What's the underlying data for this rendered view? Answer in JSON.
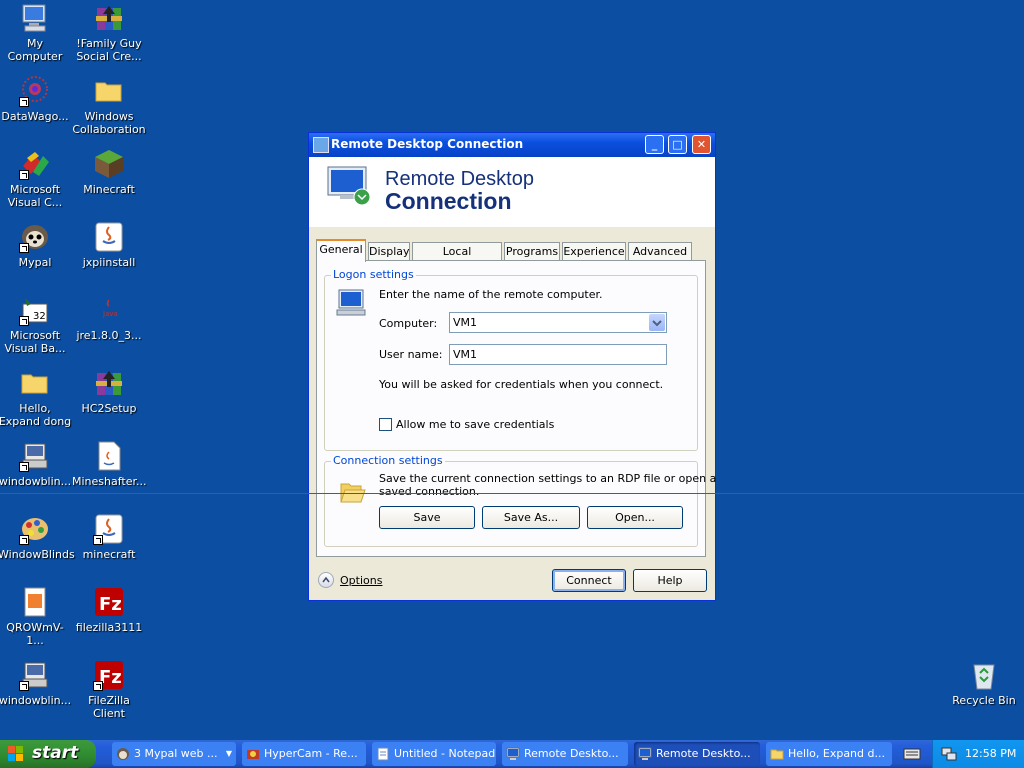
{
  "desktop": {
    "icons": [
      {
        "label": "My Computer",
        "icon": "my-computer-icon"
      },
      {
        "label": "!Family Guy Social Cre...",
        "icon": "winrar-archive-icon"
      },
      {
        "label": "DataWago...",
        "icon": "datawagon-icon"
      },
      {
        "label": "Windows Collaboration",
        "icon": "folder-icon"
      },
      {
        "label": "Microsoft Visual C...",
        "icon": "visual-cpp-icon"
      },
      {
        "label": "Minecraft",
        "icon": "minecraft-icon"
      },
      {
        "label": "Mypal",
        "icon": "mypal-icon"
      },
      {
        "label": "jxpiinstall",
        "icon": "java-icon"
      },
      {
        "label": "Microsoft Visual Ba...",
        "icon": "visual-basic-icon"
      },
      {
        "label": "jre1.8.0_3...",
        "icon": "java-installer-icon"
      },
      {
        "label": "Hello, Expand dong",
        "icon": "folder-icon"
      },
      {
        "label": "HC2Setup",
        "icon": "winrar-archive-icon"
      },
      {
        "label": "windowblin...",
        "icon": "installer-icon"
      },
      {
        "label": "Mineshafter...",
        "icon": "document-icon"
      },
      {
        "label": "WindowBlinds",
        "icon": "windowblinds-icon"
      },
      {
        "label": "minecraft",
        "icon": "java-icon"
      },
      {
        "label": "QROWmV-1...",
        "icon": "image-file-icon"
      },
      {
        "label": "filezilla3111",
        "icon": "filezilla-icon"
      },
      {
        "label": "windowblin...",
        "icon": "installer-icon"
      },
      {
        "label": "FileZilla Client",
        "icon": "filezilla-icon"
      },
      {
        "label": "Recycle Bin",
        "icon": "recycle-bin-icon"
      }
    ]
  },
  "window": {
    "title": "Remote Desktop Connection",
    "banner_line1": "Remote Desktop",
    "banner_line2": "Connection",
    "tabs": [
      "General",
      "Display",
      "Local Resources",
      "Programs",
      "Experience",
      "Advanced"
    ],
    "active_tab": "General",
    "logon": {
      "group_title": "Logon settings",
      "intro": "Enter the name of the remote computer.",
      "computer_label": "Computer:",
      "computer_value": "VM1",
      "username_label": "User name:",
      "username_value": "VM1",
      "credentials_note": "You will be asked for credentials when you connect.",
      "save_credentials_label": "Allow me to save credentials",
      "save_credentials_checked": false
    },
    "connection": {
      "group_title": "Connection settings",
      "desc_line1": "Save the current connection settings to an RDP file or open a",
      "desc_line2": "saved connection.",
      "save_label": "Save",
      "save_as_label": "Save As...",
      "open_label": "Open..."
    },
    "options_label": "Options",
    "connect_label": "Connect",
    "help_label": "Help"
  },
  "taskbar": {
    "start_label": "start",
    "items": [
      {
        "label": "3 Mypal web ...",
        "icon": "mypal-icon",
        "active": false
      },
      {
        "label": "HyperCam - Re...",
        "icon": "hypercam-icon",
        "active": false
      },
      {
        "label": "Untitled - Notepad",
        "icon": "notepad-icon",
        "active": false
      },
      {
        "label": "Remote Deskto...",
        "icon": "remote-desktop-icon",
        "active": false
      },
      {
        "label": "Remote Deskto...",
        "icon": "remote-desktop-icon",
        "active": true
      },
      {
        "label": "Hello, Expand d...",
        "icon": "folder-icon",
        "active": false
      }
    ],
    "clock": "12:58 PM"
  },
  "colors": {
    "desktop_bg": "#0b4ea2",
    "title_bar": "#0a4fde",
    "start_green": "#2f8a2f",
    "overlay_line": "#e0201e"
  }
}
